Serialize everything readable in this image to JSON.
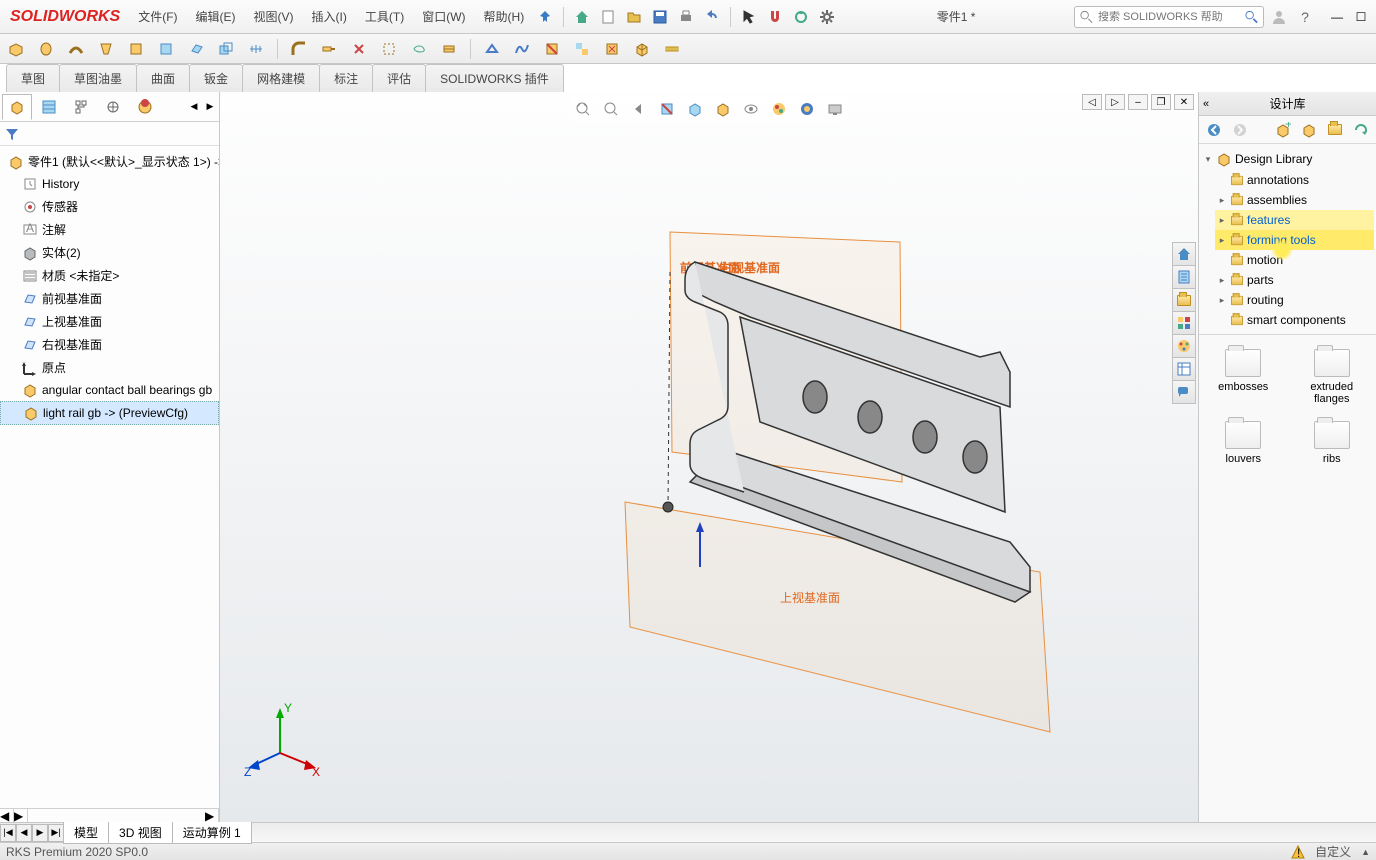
{
  "app": {
    "name": "SOLIDWORKS",
    "doc": "零件1 *",
    "search_placeholder": "搜索 SOLIDWORKS 帮助"
  },
  "menu": [
    "文件(F)",
    "编辑(E)",
    "视图(V)",
    "插入(I)",
    "工具(T)",
    "窗口(W)",
    "帮助(H)"
  ],
  "cmdtabs": [
    "草图",
    "草图油墨",
    "曲面",
    "钣金",
    "网格建模",
    "标注",
    "评估",
    "SOLIDWORKS 插件"
  ],
  "feature_tree": {
    "root": "零件1 (默认<<默认>_显示状态 1>) ->",
    "items": [
      {
        "icon": "history",
        "label": "History"
      },
      {
        "icon": "sensor",
        "label": "传感器"
      },
      {
        "icon": "annot",
        "label": "注解"
      },
      {
        "icon": "solid",
        "label": "实体(2)"
      },
      {
        "icon": "material",
        "label": "材质 <未指定>"
      },
      {
        "icon": "plane",
        "label": "前视基准面"
      },
      {
        "icon": "plane",
        "label": "上视基准面"
      },
      {
        "icon": "plane",
        "label": "右视基准面"
      },
      {
        "icon": "origin",
        "label": "原点"
      },
      {
        "icon": "part",
        "label": "angular contact ball bearings gb"
      },
      {
        "icon": "part",
        "label": "light rail gb -> (PreviewCfg)",
        "sel": true
      }
    ]
  },
  "viewport": {
    "planes": {
      "front": "前视基准面",
      "right": "右视基准面",
      "top": "上视基准面"
    },
    "axes": {
      "x": "X",
      "y": "Y",
      "z": "Z"
    }
  },
  "design_lib": {
    "title": "设计库",
    "root": "Design Library",
    "folders": [
      "annotations",
      "assemblies",
      "features",
      "forming tools",
      "motion",
      "parts",
      "routing",
      "smart components"
    ],
    "highlighted": "forming tools",
    "items": [
      "embosses",
      "extruded flanges",
      "louvers",
      "ribs"
    ]
  },
  "bottom_tabs": [
    "模型",
    "3D 视图",
    "运动算例 1"
  ],
  "status": {
    "left": "RKS Premium 2020 SP0.0",
    "right": "自定义"
  }
}
